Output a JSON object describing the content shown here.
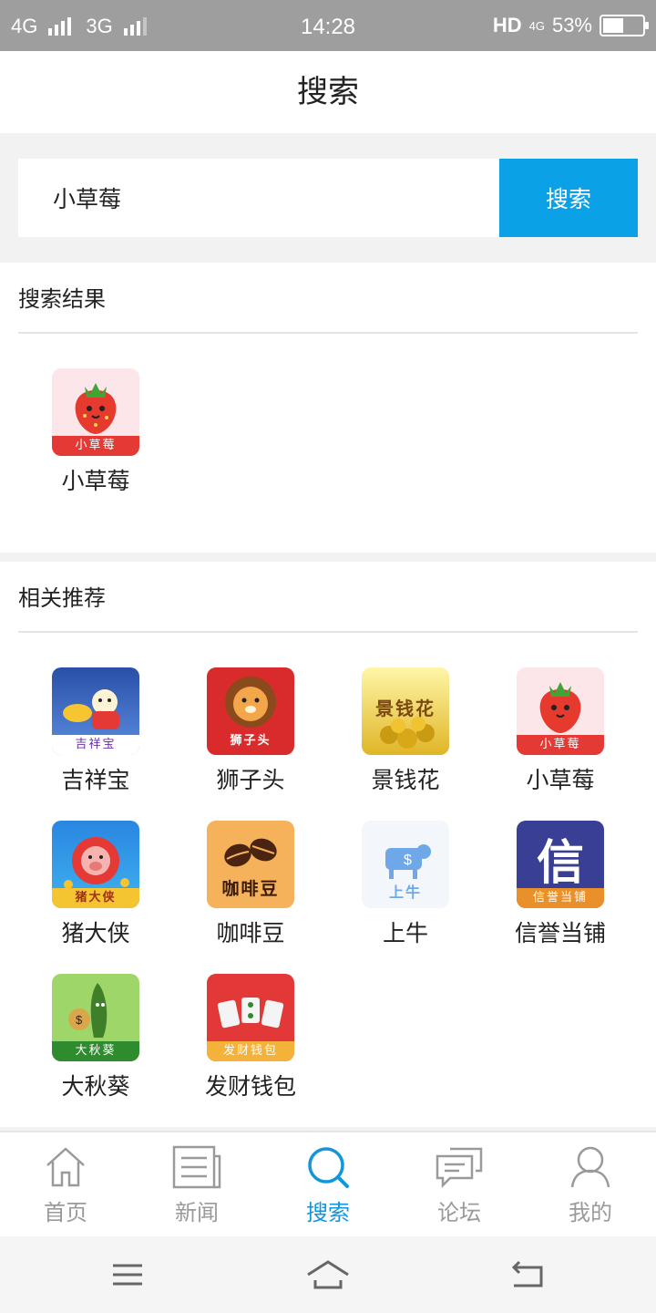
{
  "status_bar": {
    "network1": "4G",
    "network2": "3G",
    "time": "14:28",
    "hd": "HD",
    "lte": "4G",
    "battery": "53%",
    "battery_level": 0.53
  },
  "header": {
    "title": "搜索"
  },
  "search": {
    "value": "小草莓",
    "button_label": "搜索"
  },
  "results": {
    "title": "搜索结果",
    "items": [
      {
        "label": "小草莓",
        "icon": "strawberry-app-icon",
        "badge": "小草莓"
      }
    ]
  },
  "recommend": {
    "title": "相关推荐",
    "items": [
      {
        "label": "吉祥宝",
        "icon": "jixiangbao-app-icon",
        "badge": "吉祥宝"
      },
      {
        "label": "狮子头",
        "icon": "lion-app-icon",
        "badge": "狮子头"
      },
      {
        "label": "景钱花",
        "icon": "gold-coins-app-icon",
        "badge": "景钱花"
      },
      {
        "label": "小草莓",
        "icon": "strawberry-app-icon",
        "badge": "小草莓"
      },
      {
        "label": "猪大侠",
        "icon": "pig-app-icon",
        "badge": "猪大侠"
      },
      {
        "label": "咖啡豆",
        "icon": "coffee-bean-app-icon",
        "badge": "咖啡豆"
      },
      {
        "label": "上牛",
        "icon": "bull-app-icon",
        "badge": "上牛"
      },
      {
        "label": "信誉当铺",
        "icon": "pawnshop-app-icon",
        "badge": "信誉当铺",
        "glyph": "信"
      },
      {
        "label": "大秋葵",
        "icon": "okra-app-icon",
        "badge": "大秋葵"
      },
      {
        "label": "发财钱包",
        "icon": "mahjong-app-icon",
        "badge": "发财钱包"
      }
    ]
  },
  "tabs": [
    {
      "label": "首页",
      "icon": "home-icon",
      "active": false
    },
    {
      "label": "新闻",
      "icon": "news-icon",
      "active": false
    },
    {
      "label": "搜索",
      "icon": "search-icon",
      "active": true
    },
    {
      "label": "论坛",
      "icon": "forum-icon",
      "active": false
    },
    {
      "label": "我的",
      "icon": "profile-icon",
      "active": false
    }
  ],
  "colors": {
    "accent": "#0aa1e6",
    "active_tab": "#1296db",
    "inactive_tab": "#9a9a9a"
  }
}
